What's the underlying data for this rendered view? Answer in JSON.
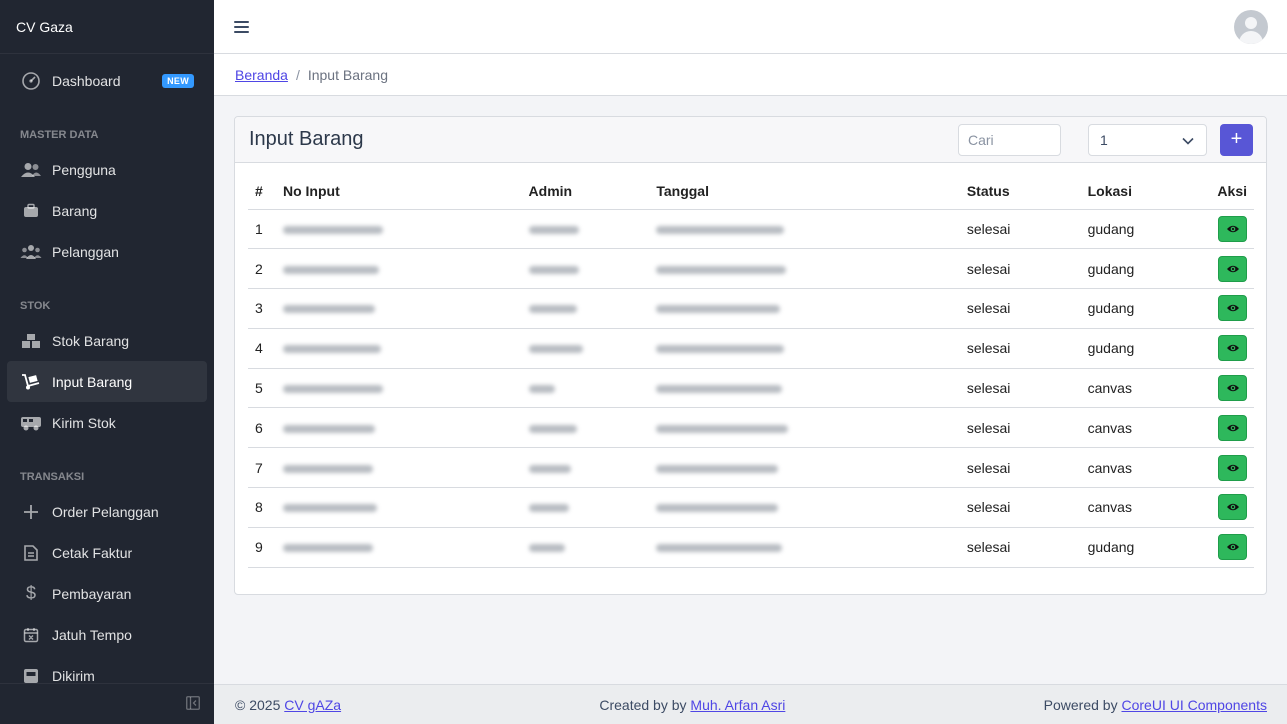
{
  "sidebar": {
    "brand": "CV Gaza",
    "dashboard": {
      "label": "Dashboard",
      "badge": "NEW"
    },
    "section_master": "MASTER DATA",
    "pengguna": "Pengguna",
    "barang": "Barang",
    "pelanggan": "Pelanggan",
    "section_stok": "STOK",
    "stok_barang": "Stok Barang",
    "input_barang": "Input Barang",
    "kirim_stok": "Kirim Stok",
    "section_transaksi": "TRANSAKSI",
    "order_pelanggan": "Order Pelanggan",
    "cetak_faktur": "Cetak Faktur",
    "pembayaran": "Pembayaran",
    "jatuh_tempo": "Jatuh Tempo",
    "dikirim": "Dikirim"
  },
  "breadcrumb": {
    "home": "Beranda",
    "sep": "/",
    "current": "Input Barang"
  },
  "card": {
    "title": "Input Barang",
    "search_placeholder": "Cari",
    "select_value": "1",
    "add_label": "+"
  },
  "table": {
    "headers": {
      "num": "#",
      "no_input": "No Input",
      "admin": "Admin",
      "tanggal": "Tanggal",
      "status": "Status",
      "lokasi": "Lokasi",
      "aksi": "Aksi"
    },
    "rows": [
      {
        "num": "1",
        "status": "selesai",
        "lokasi": "gudang"
      },
      {
        "num": "2",
        "status": "selesai",
        "lokasi": "gudang"
      },
      {
        "num": "3",
        "status": "selesai",
        "lokasi": "gudang"
      },
      {
        "num": "4",
        "status": "selesai",
        "lokasi": "gudang"
      },
      {
        "num": "5",
        "status": "selesai",
        "lokasi": "canvas"
      },
      {
        "num": "6",
        "status": "selesai",
        "lokasi": "canvas"
      },
      {
        "num": "7",
        "status": "selesai",
        "lokasi": "canvas"
      },
      {
        "num": "8",
        "status": "selesai",
        "lokasi": "canvas"
      },
      {
        "num": "9",
        "status": "selesai",
        "lokasi": "gudang"
      }
    ]
  },
  "footer": {
    "copyright": "© 2025",
    "brand_link": "CV gAZa",
    "created_by": "Created by by",
    "author_link": "Muh. Arfan Asri",
    "powered_by": "Powered by",
    "powered_link": "CoreUI UI Components"
  },
  "colors": {
    "sidebar_bg": "#212631",
    "primary": "#5856d6",
    "success": "#2eb85c",
    "link": "#4f46e5"
  }
}
